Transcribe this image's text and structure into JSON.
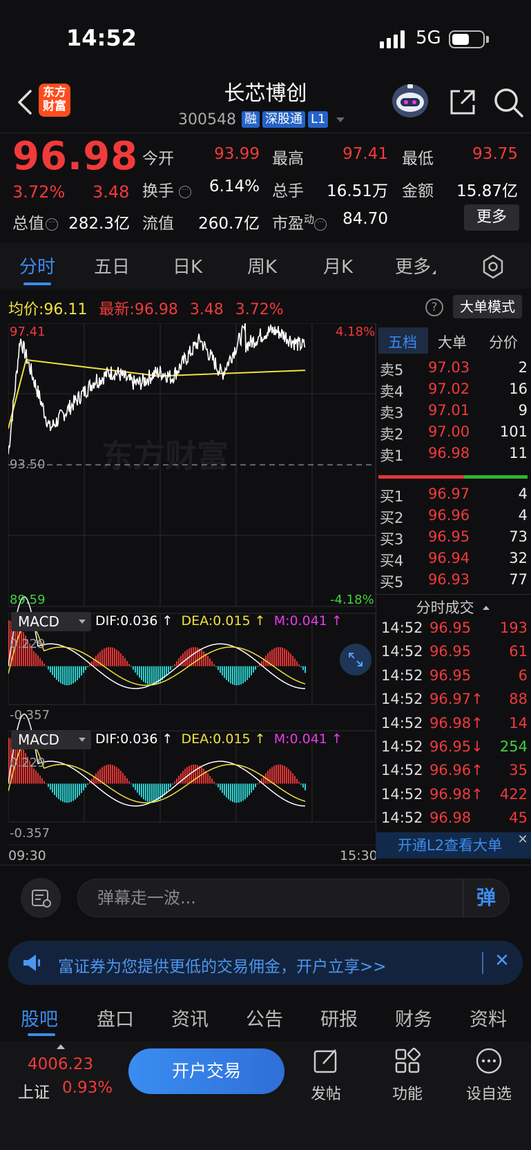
{
  "status": {
    "time": "14:52",
    "network": "5G"
  },
  "header": {
    "logo": "东方财富",
    "name": "长芯博创",
    "code": "300548",
    "badges": [
      "融",
      "深股通",
      "L1"
    ]
  },
  "quote": {
    "price": "96.98",
    "change_pct": "3.72%",
    "change_val": "3.48",
    "fields": [
      {
        "label": "今开",
        "value": "93.99",
        "color": "red"
      },
      {
        "label": "最高",
        "value": "97.41",
        "color": "red"
      },
      {
        "label": "最低",
        "value": "93.75",
        "color": "red"
      },
      {
        "label": "换手",
        "value": "6.14%",
        "color": "white"
      },
      {
        "label": "总手",
        "value": "16.51万",
        "color": "white"
      },
      {
        "label": "金额",
        "value": "15.87亿",
        "color": "white"
      },
      {
        "label": "总值",
        "value": "282.3亿",
        "color": "white"
      },
      {
        "label": "流值",
        "value": "260.7亿",
        "color": "white"
      },
      {
        "label": "市盈",
        "value": "84.70",
        "color": "white"
      }
    ],
    "pe_sup": "动",
    "more": "更多"
  },
  "chart_tabs": [
    "分时",
    "五日",
    "日K",
    "周K",
    "月K",
    "更多"
  ],
  "avg_row": {
    "avg_label": "均价:",
    "avg_value": "96.11",
    "latest_label": "最新:",
    "latest_value": "96.98",
    "chg": "3.48",
    "pct": "3.72%"
  },
  "bigorder_mode": "大单模式",
  "chart_labels": {
    "high": "97.41",
    "mid": "93.50",
    "low": "89.59",
    "pct_high": "4.18%",
    "pct_low": "-4.18%",
    "watermark": "东方财富",
    "time_start": "09:30",
    "time_end": "15:30"
  },
  "macd": {
    "name": "MACD",
    "dif": "DIF:0.036 ↑",
    "dea": "DEA:0.015 ↑",
    "m": "M:0.041 ↑",
    "top": "0.229",
    "bottom": "-0.357"
  },
  "orderbook": {
    "tabs": [
      "五档",
      "大单",
      "分价"
    ],
    "sells": [
      {
        "label": "卖5",
        "price": "97.03",
        "vol": "2"
      },
      {
        "label": "卖4",
        "price": "97.02",
        "vol": "16"
      },
      {
        "label": "卖3",
        "price": "97.01",
        "vol": "9"
      },
      {
        "label": "卖2",
        "price": "97.00",
        "vol": "101"
      },
      {
        "label": "卖1",
        "price": "96.98",
        "vol": "11"
      }
    ],
    "buys": [
      {
        "label": "买1",
        "price": "96.97",
        "vol": "4"
      },
      {
        "label": "买2",
        "price": "96.96",
        "vol": "4"
      },
      {
        "label": "买3",
        "price": "96.95",
        "vol": "73"
      },
      {
        "label": "买4",
        "price": "96.94",
        "vol": "32"
      },
      {
        "label": "买5",
        "price": "96.93",
        "vol": "77"
      }
    ],
    "ticks_title": "分时成交",
    "ticks": [
      {
        "time": "14:52",
        "price": "96.95",
        "vol": "193",
        "color": "red"
      },
      {
        "time": "14:52",
        "price": "96.95",
        "vol": "61",
        "color": "red"
      },
      {
        "time": "14:52",
        "price": "96.95",
        "vol": "6",
        "color": "red"
      },
      {
        "time": "14:52",
        "price": "96.97↑",
        "vol": "88",
        "color": "red"
      },
      {
        "time": "14:52",
        "price": "96.98↑",
        "vol": "14",
        "color": "red"
      },
      {
        "time": "14:52",
        "price": "96.95↓",
        "vol": "254",
        "color": "green"
      },
      {
        "time": "14:52",
        "price": "96.96↑",
        "vol": "35",
        "color": "red"
      },
      {
        "time": "14:52",
        "price": "96.98↑",
        "vol": "422",
        "color": "red"
      },
      {
        "time": "14:52",
        "price": "96.98",
        "vol": "45",
        "color": "red"
      }
    ],
    "l2_banner": "开通L2查看大单"
  },
  "danmu": {
    "placeholder": "弹幕走一波...",
    "send": "弹"
  },
  "ad": {
    "text": "富证券为您提供更低的交易佣金，开户立享>>"
  },
  "bottom_tabs": [
    "股吧",
    "盘口",
    "资讯",
    "公告",
    "研报",
    "财务",
    "资料"
  ],
  "bottom_bar": {
    "index_value": "4006.23",
    "index_name": "上证",
    "index_pct": "0.93%",
    "trade": "开户交易",
    "items": [
      "发帖",
      "功能",
      "设自选"
    ]
  },
  "colors": {
    "up": "#f23a3a",
    "down": "#3fd23f",
    "accent": "#3b8cf0",
    "avg_line": "#f2e13d"
  }
}
